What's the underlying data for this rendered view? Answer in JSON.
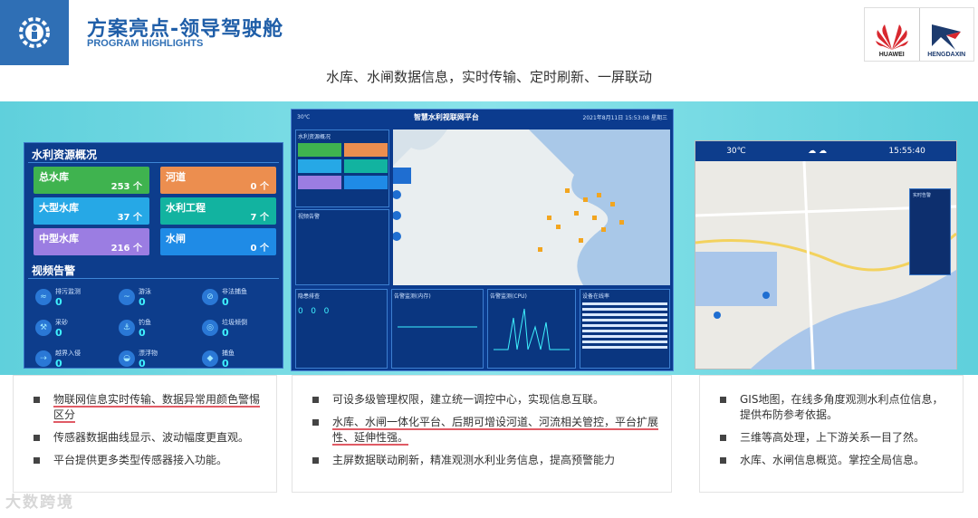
{
  "header": {
    "title": "方案亮点-领导驾驶舱",
    "subtitle": "PROGRAM HIGHLIGHTS"
  },
  "brand": {
    "huawei": "HUAWEI",
    "hengdaxin": "HENGDAXIN"
  },
  "headline": "水库、水闸数据信息，实时传输、定时刷新、一屏联动",
  "left_panel": {
    "title": "水利资源概况",
    "tiles": [
      {
        "label": "总水库",
        "value": "253 个",
        "color": "#3fb34f"
      },
      {
        "label": "河道",
        "value": "0 个",
        "color": "#ec8e4f"
      },
      {
        "label": "大型水库",
        "value": "37 个",
        "color": "#26a8e6"
      },
      {
        "label": "水利工程",
        "value": "7 个",
        "color": "#12b3a0"
      },
      {
        "label": "中型水库",
        "value": "216 个",
        "color": "#9b7de2"
      },
      {
        "label": "水闸",
        "value": "0 个",
        "color": "#1f8be6"
      }
    ],
    "alarm_title": "视频告警",
    "alarms": [
      {
        "label": "排污监测",
        "value": "0",
        "icon": "outfall-icon"
      },
      {
        "label": "游泳",
        "value": "0",
        "icon": "swim-icon"
      },
      {
        "label": "非法捕鱼",
        "value": "0",
        "icon": "no-fishing-icon"
      },
      {
        "label": "采砂",
        "value": "0",
        "icon": "excavator-icon"
      },
      {
        "label": "钓鱼",
        "value": "0",
        "icon": "fishing-icon"
      },
      {
        "label": "垃圾倾倒",
        "value": "0",
        "icon": "garbage-icon"
      },
      {
        "label": "越界入侵",
        "value": "0",
        "icon": "intrusion-icon"
      },
      {
        "label": "漂浮物",
        "value": "0",
        "icon": "float-icon"
      },
      {
        "label": "捕鱼",
        "value": "0",
        "icon": "fish-icon"
      }
    ]
  },
  "center_panel": {
    "weather": "30℃",
    "title": "智慧水利视联网平台",
    "datetime": "2021年8月11日 15:53:08 星期三",
    "side_title": "水利资源概况",
    "alarm_title": "视频告警",
    "bottom": [
      "隐患排查",
      "告警监测(内存)",
      "告警监测(CPU)",
      "设备在线率"
    ]
  },
  "right_panel": {
    "temp": "30℃",
    "time": "15:55:40",
    "popup_title": "实时告警"
  },
  "cards": [
    {
      "items": [
        {
          "text": "物联网信息实时传输、数据异常用颜色警惕区分",
          "underline": true
        },
        {
          "text": "传感器数据曲线显示、波动幅度更直观。",
          "underline": false
        },
        {
          "text": "平台提供更多类型传感器接入功能。",
          "underline": false
        }
      ]
    },
    {
      "items": [
        {
          "text": "可设多级管理权限，建立统一调控中心，实现信息互联。",
          "underline": false
        },
        {
          "text": "水库、水闸一体化平台、后期可增设河道、河流相关管控，平台扩展性、延伸性强。",
          "underline": true
        },
        {
          "text": "主屏数据联动刷新，精准观测水利业务信息，提高预警能力",
          "underline": false
        }
      ]
    },
    {
      "items": [
        {
          "text": "GIS地图，在线多角度观测水利点位信息，提供布防参考依据。",
          "underline": false
        },
        {
          "text": "三维等高处理，上下游关系一目了然。",
          "underline": false
        },
        {
          "text": "水库、水闸信息概览。掌控全局信息。",
          "underline": false
        }
      ]
    }
  ],
  "watermark": "大数跨境"
}
